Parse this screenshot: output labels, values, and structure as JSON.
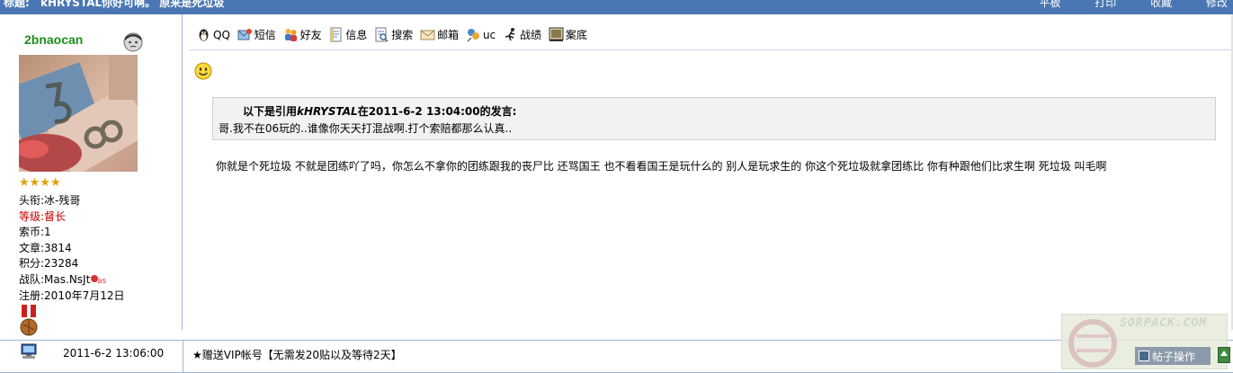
{
  "title_bar": {
    "label": "标题:",
    "thread_title": "kHRYSTAL你好可啊。 原来是死垃圾",
    "actions": [
      "平板",
      "打印",
      "收藏",
      "修改"
    ]
  },
  "author": {
    "username": "2bnaocan",
    "star_count": 4,
    "stars": "★★★★",
    "fields": [
      {
        "label": "头衔:",
        "value": "冰-残哥",
        "color": "#000000"
      },
      {
        "label": "等级:",
        "value": "督长",
        "color": "#c00000"
      },
      {
        "label": "索币:",
        "value": "1",
        "color": "#000000"
      },
      {
        "label": "文章:",
        "value": "3814",
        "color": "#000000"
      },
      {
        "label": "积分:",
        "value": "23284",
        "color": "#000000"
      },
      {
        "label": "战队:",
        "value": "Mas.NsJt",
        "color": "#000000"
      },
      {
        "label": "注册:",
        "value": "2010年7月12日",
        "color": "#000000"
      }
    ]
  },
  "toolbar": [
    {
      "label": "QQ",
      "icon": "qq-penguin-icon"
    },
    {
      "label": "短信",
      "icon": "message-icon"
    },
    {
      "label": "好友",
      "icon": "friends-icon"
    },
    {
      "label": "信息",
      "icon": "info-document-icon"
    },
    {
      "label": "搜索",
      "icon": "search-document-icon"
    },
    {
      "label": "邮箱",
      "icon": "envelope-icon"
    },
    {
      "label": "uc",
      "icon": "uc-chat-icon"
    },
    {
      "label": "战绩",
      "icon": "runner-icon"
    },
    {
      "label": "案底",
      "icon": "record-frame-icon"
    }
  ],
  "post": {
    "quote": {
      "prefix": "以下是引用",
      "author": "kHRYSTAL",
      "middle": "在2011-6-2 13:04:00的发言:",
      "text": "哥.我不在06玩的..谁像你天天打混战啊.打个索赔都那么认真.."
    },
    "message": "你就是个死垃圾  不就是团练吖了吗，你怎么不拿你的团练跟我的丧尸比  还骂国王  也不看看国王是玩什么的  别人是玩求生的  你这个死垃圾就拿团练比  你有种跟他们比求生啊  死垃圾  叫毛啊"
  },
  "footer": {
    "date": "2011-6-2 13:06:00",
    "signature": "★赠送VIP帐号【无需发20贴以及等待2天】",
    "post_action_label": "帖子操作",
    "watermark": "SORPACK.COM"
  },
  "colors": {
    "title_bar": "#4a77b4",
    "username": "#1c8f1c",
    "stars": "#e0a000",
    "level": "#c00000",
    "border": "#9fb6d8",
    "quote_bg": "#f2f2f2"
  }
}
